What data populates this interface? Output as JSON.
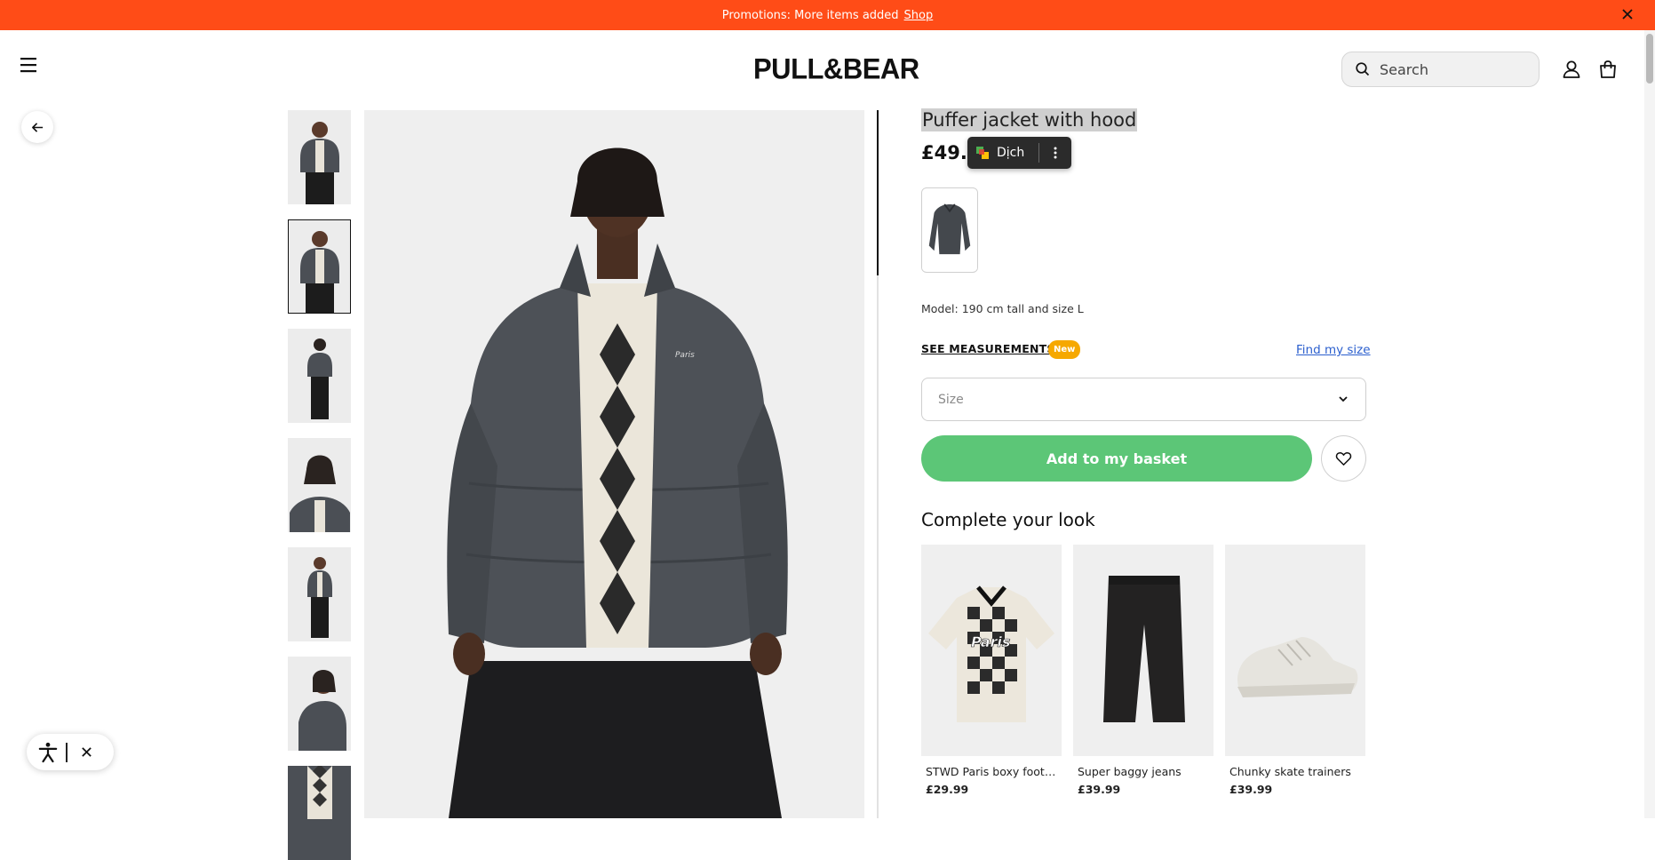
{
  "promo": {
    "text": "Promotions: More items added",
    "link_label": "Shop",
    "bg_color": "#ff4c17",
    "close_icon": "close-icon"
  },
  "header": {
    "menu_icon": "hamburger-menu-icon",
    "logo": "PULL&BEAR",
    "search_placeholder": "Search",
    "search_icon": "search-icon",
    "user_icon": "user-icon",
    "bag_icon": "shopping-bag-icon"
  },
  "navigation": {
    "back_icon": "arrow-left-icon"
  },
  "gallery": {
    "thumbnail_count": 7,
    "active_thumbnail": 2,
    "main_image_alt": "Model wearing grey puffer jacket with patterned top and black jeans"
  },
  "product": {
    "title": "Puffer jacket with hood",
    "price": "£49.9",
    "model_info": "Model: 190 cm tall and size L",
    "see_measurements": "SEE MEASUREMENTS",
    "new_badge": "New",
    "find_my_size": "Find my size",
    "size_placeholder": "Size",
    "add_to_basket": "Add to my basket",
    "fav_icon": "heart-icon",
    "accent_color": "#5cc677"
  },
  "translate_popup": {
    "label": "Dịch",
    "more_icon": "more-vertical-icon"
  },
  "complete_look": {
    "title": "Complete your look",
    "items": [
      {
        "name": "STWD Paris boxy footba...",
        "price": "£29.99"
      },
      {
        "name": "Super baggy jeans",
        "price": "£39.99"
      },
      {
        "name": "Chunky skate trainers",
        "price": "£39.99"
      }
    ]
  },
  "accessibility": {
    "icon": "accessibility-icon",
    "close_icon": "close-icon"
  }
}
